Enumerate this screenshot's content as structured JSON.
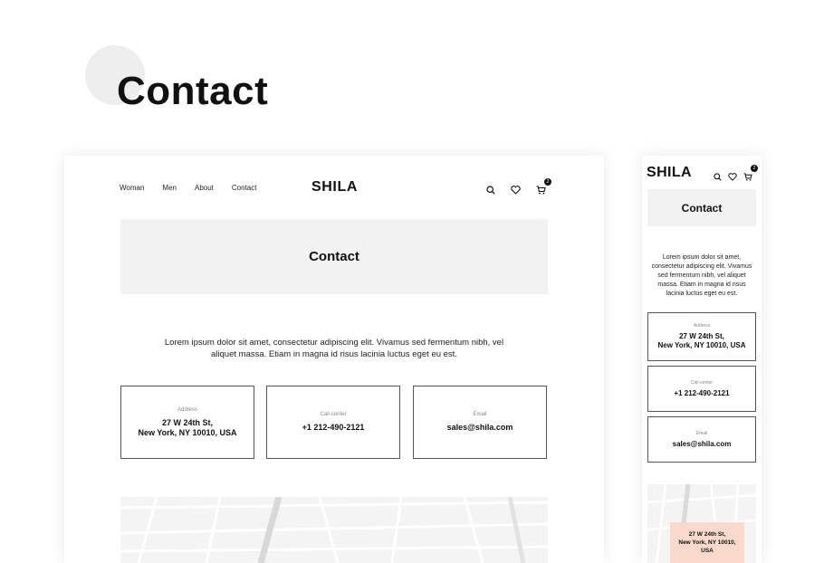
{
  "page": {
    "title": "Contact"
  },
  "desktop": {
    "nav": [
      "Woman",
      "Men",
      "About",
      "Contact"
    ],
    "logo": "SHILA",
    "cart_count": "2",
    "hero_title": "Contact",
    "intro": "Lorem ipsum dolor sit amet, consectetur adipiscing elit. Vivamus sed fermentum nibh, vel aliquet massa. Etiam in magna id risus lacinia luctus eget eu est.",
    "cards": [
      {
        "label": "Address",
        "value": "27 W 24th St,\nNew York, NY 10010, USA"
      },
      {
        "label": "Call-center",
        "value": "+1 212-490-2121"
      },
      {
        "label": "Email",
        "value": "sales@shila.com"
      }
    ]
  },
  "mobile": {
    "logo": "SHILA",
    "cart_count": "2",
    "hero_title": "Contact",
    "intro": "Lorem ipsum dolor sit amet, consectetur adipiscing elit. Vivamus sed fermentum nibh, vel aliquet massa. Etiam in magna id risus lacinia luctus eget eu est.",
    "cards": [
      {
        "label": "Address",
        "value": "27 W 24th St,\nNew York, NY 10010, USA"
      },
      {
        "label": "Call-center",
        "value": "+1 212-490-2121"
      },
      {
        "label": "Email",
        "value": "sales@shila.com"
      }
    ],
    "map_pin": "27 W 24th St,\nNew York, NY 10010,\nUSA"
  },
  "icons": {
    "search": "search-icon",
    "wishlist": "heart-icon",
    "cart": "cart-icon"
  },
  "colors": {
    "hero_bg": "#f2f2f2",
    "accent_pin": "#fbd9cc",
    "text": "#111111"
  }
}
